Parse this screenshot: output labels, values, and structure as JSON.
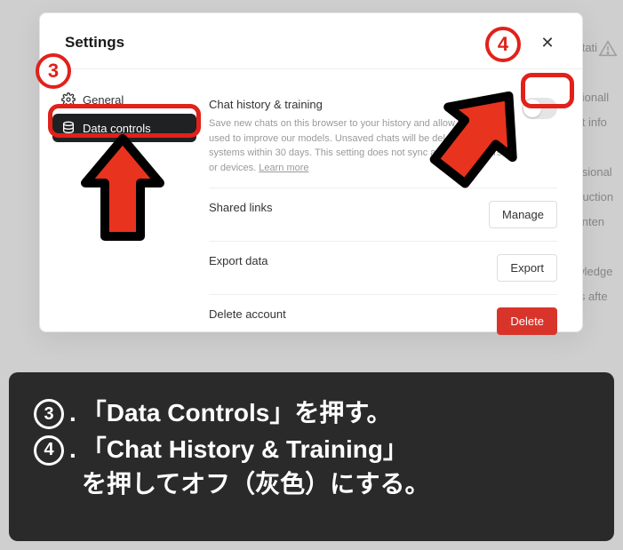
{
  "bgWarnLines": [
    "mitati",
    "asionall",
    "ect info",
    "casional",
    "struction",
    "conten",
    "owledge",
    "nts afte"
  ],
  "modal": {
    "title": "Settings",
    "close": "✕"
  },
  "sidebar": {
    "general": "General",
    "dataControls": "Data controls"
  },
  "sections": {
    "history": {
      "title": "Chat history & training",
      "desc_a": "Save new chats on this browser to your history and allow them to be used to improve our models. Unsaved chats will be deleted from our systems within 30 days. This setting does not sync across browsers or devices. ",
      "learn": "Learn more"
    },
    "shared": {
      "title": "Shared links",
      "button": "Manage"
    },
    "export": {
      "title": "Export data",
      "button": "Export"
    },
    "delete": {
      "title": "Delete account",
      "button": "Delete"
    }
  },
  "anno": {
    "num3": "3",
    "num4": "4"
  },
  "caption": {
    "line3_num": "3",
    "line3_dot": ".",
    "line3_text": "「Data Controls」を押す。",
    "line4_num": "4",
    "line4_dot": ".",
    "line4_text": "「Chat History & Training」",
    "line4_sub": "を押してオフ（灰色）にする。"
  }
}
